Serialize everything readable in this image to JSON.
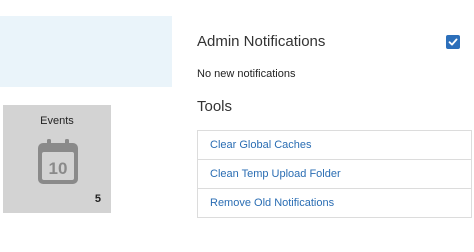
{
  "events": {
    "title": "Events",
    "calendar_day": "10",
    "count": "5"
  },
  "admin_notifications": {
    "title": "Admin Notifications",
    "enabled": true,
    "empty_message": "No new notifications"
  },
  "tools": {
    "title": "Tools",
    "items": [
      {
        "label": "Clear Global Caches"
      },
      {
        "label": "Clean Temp Upload Folder"
      },
      {
        "label": "Remove Old Notifications"
      }
    ]
  },
  "colors": {
    "accent": "#2c6fba",
    "link": "#2a6db3",
    "panel": "#eaf4fa",
    "tile": "#d3d3d3"
  },
  "icons": {
    "calendar": "calendar-icon",
    "checkbox": "checkmark-icon"
  }
}
